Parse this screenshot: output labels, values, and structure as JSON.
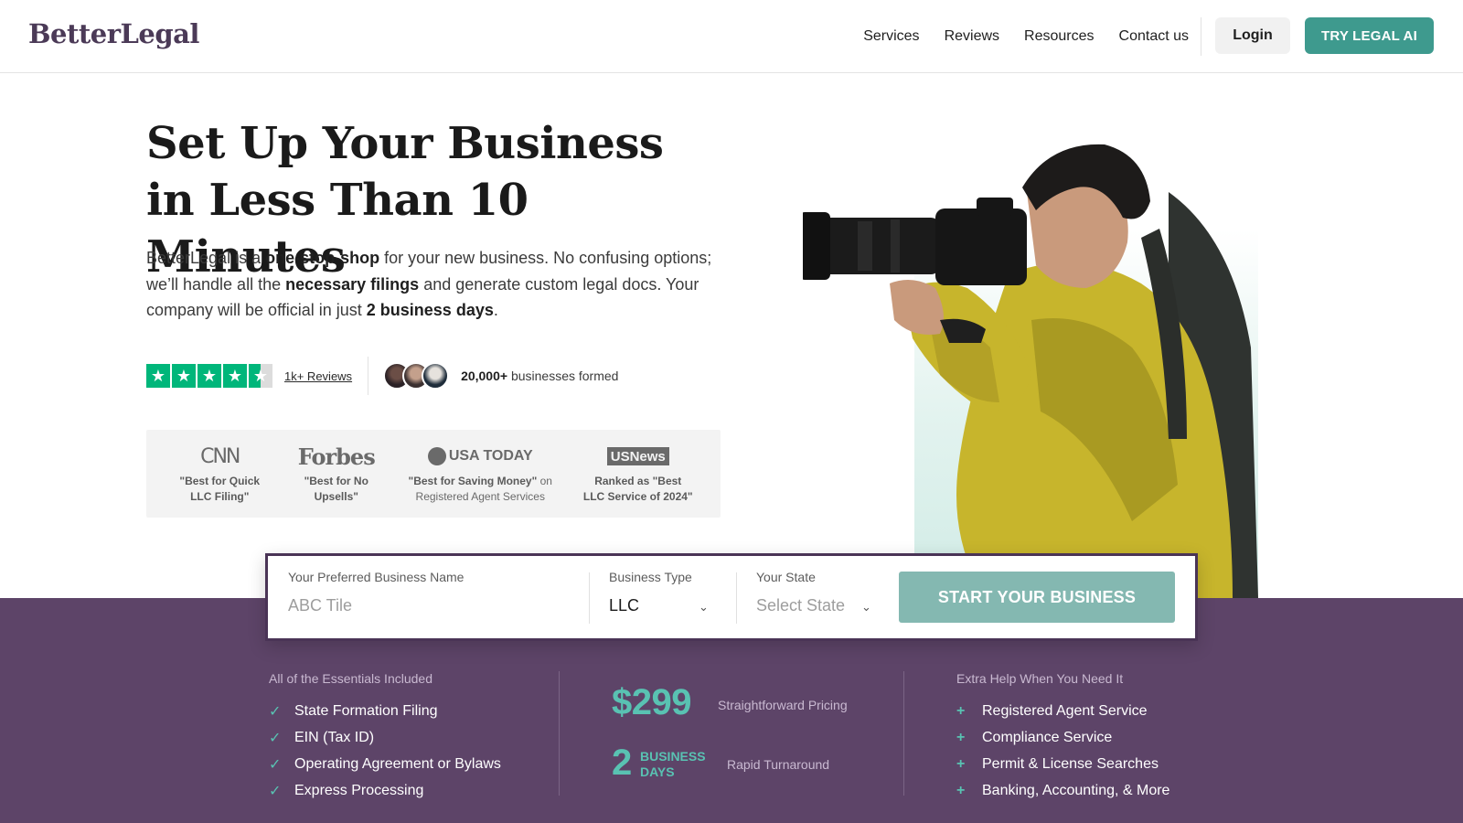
{
  "brand": {
    "logo": "BetterLegal"
  },
  "nav": {
    "items": [
      "Services",
      "Reviews",
      "Resources",
      "Contact us"
    ],
    "login": "Login",
    "cta": "TRY LEGAL AI"
  },
  "hero": {
    "title": "Set Up Your Business in Less Than 10 Minutes",
    "subtitle_parts": {
      "p1": "BetterLegal is a ",
      "b1": "one-stop-shop",
      "p2": " for your new business. No confusing options; we’ll handle all the ",
      "b2": "necessary filings",
      "p3": " and generate custom legal docs. Your company will be official in just ",
      "b3": "2 business days",
      "p4": "."
    }
  },
  "rating": {
    "stars": 4.5,
    "reviews_link": "1k+ Reviews",
    "formed_count": "20,000+",
    "formed_text": " businesses formed"
  },
  "press": [
    {
      "logo": "CNN",
      "caption_bold": "\"Best for Quick LLC Filing\"",
      "caption_rest": ""
    },
    {
      "logo": "Forbes",
      "caption_bold": "\"Best for No Upsells\"",
      "caption_rest": ""
    },
    {
      "logo": "USA TODAY",
      "caption_bold": "\"Best for Saving Money\"",
      "caption_rest": " on Registered Agent Services"
    },
    {
      "logo": "USNews",
      "caption_bold": "Ranked as \"Best LLC Service of 2024\"",
      "caption_rest": ""
    }
  ],
  "form": {
    "name_label": "Your Preferred Business Name",
    "name_placeholder": "ABC Tile",
    "type_label": "Business Type",
    "type_value": "LLC",
    "state_label": "Your State",
    "state_placeholder": "Select State",
    "submit": "START YOUR BUSINESS"
  },
  "essentials": {
    "label": "All of the Essentials Included",
    "items": [
      "State Formation Filing",
      "EIN (Tax ID)",
      "Operating Agreement or Bylaws",
      "Express Processing"
    ]
  },
  "pricing": {
    "price": "$299",
    "price_label": "Straightforward Pricing",
    "days_num": "2",
    "days_word": "BUSINESS DAYS",
    "turnaround_label": "Rapid Turnaround"
  },
  "extras": {
    "label": "Extra Help When You Need It",
    "items": [
      "Registered Agent Service",
      "Compliance Service",
      "Permit & License Searches",
      "Banking, Accounting, & More"
    ]
  },
  "colors": {
    "brand_purple": "#5d4468",
    "teal": "#3e9a8e",
    "star_green": "#00b67a"
  }
}
